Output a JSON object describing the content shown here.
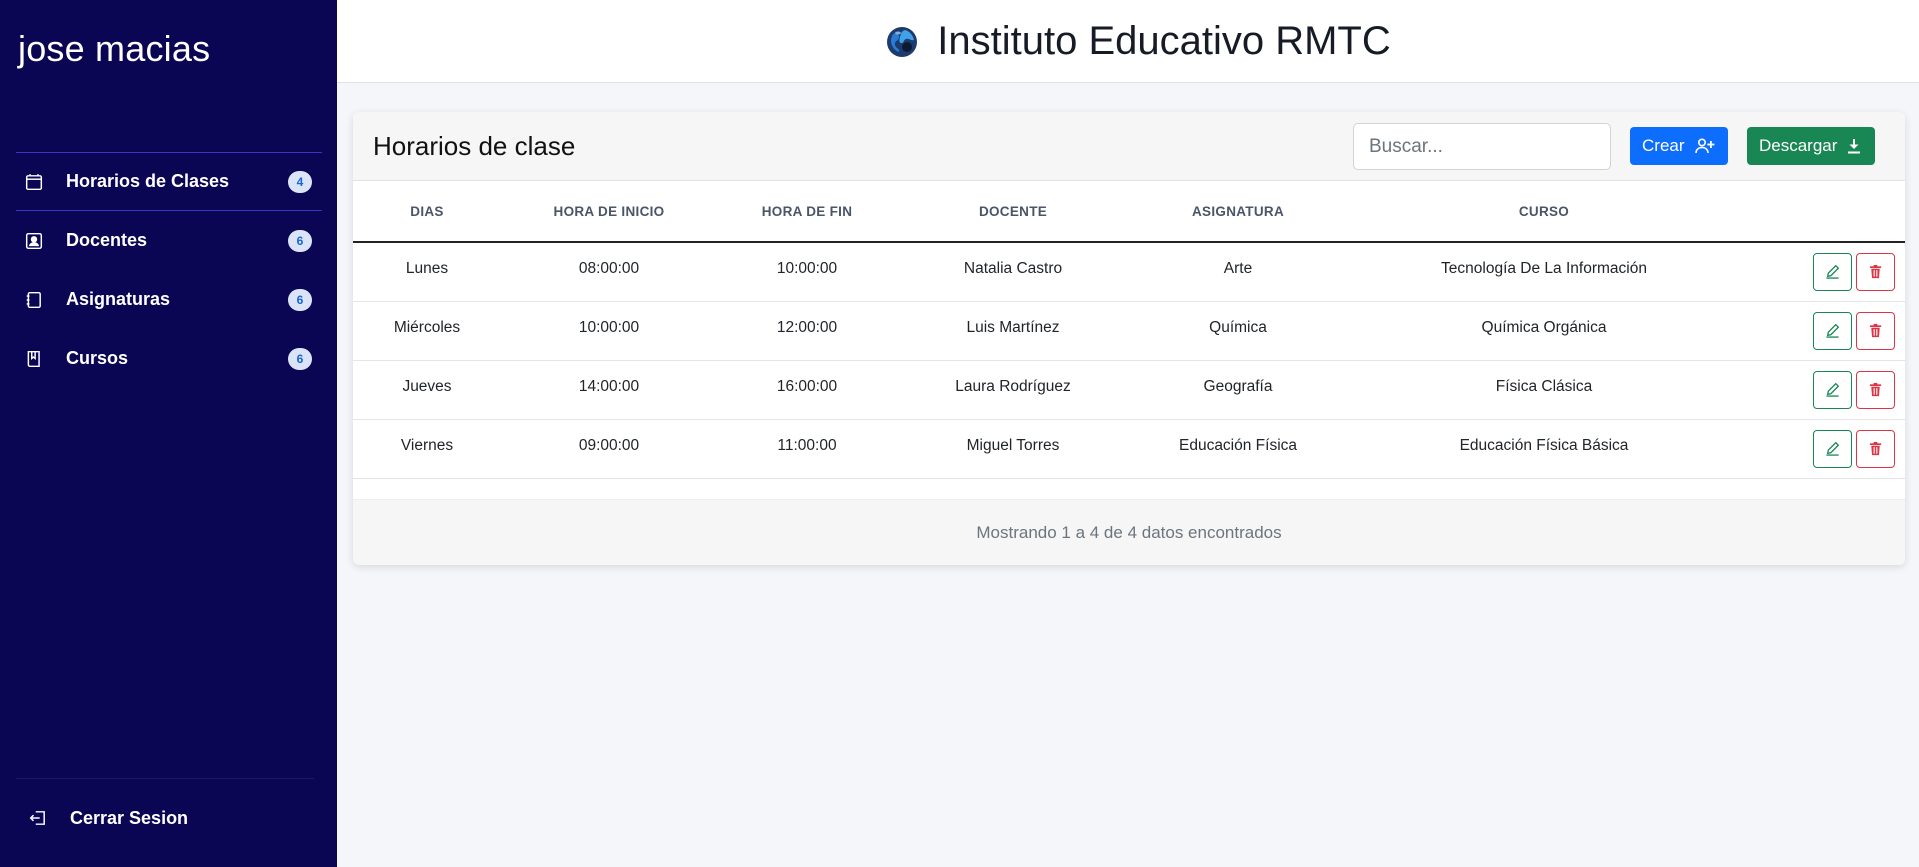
{
  "sidebar": {
    "user_name": "jose macias",
    "items": [
      {
        "label": "Horarios de Clases",
        "badge": "4",
        "icon": "calendar-icon"
      },
      {
        "label": "Docentes",
        "badge": "6",
        "icon": "person-badge-icon"
      },
      {
        "label": "Asignaturas",
        "badge": "6",
        "icon": "journal-icon"
      },
      {
        "label": "Cursos",
        "badge": "6",
        "icon": "bookmark-book-icon"
      }
    ],
    "logout_label": "Cerrar Sesion"
  },
  "header": {
    "title": "Instituto Educativo RMTC",
    "logo_icon": "globe-icon"
  },
  "card": {
    "title": "Horarios de clase",
    "search_placeholder": "Buscar...",
    "create_label": "Crear",
    "download_label": "Descargar",
    "footer_text": "Mostrando 1 a 4 de 4 datos encontrados"
  },
  "table": {
    "columns": [
      "DIAS",
      "HORA DE INICIO",
      "HORA DE FIN",
      "DOCENTE",
      "ASIGNATURA",
      "CURSO"
    ],
    "rows": [
      [
        "Lunes",
        "08:00:00",
        "10:00:00",
        "Natalia Castro",
        "Arte",
        "Tecnología De La Información"
      ],
      [
        "Miércoles",
        "10:00:00",
        "12:00:00",
        "Luis Martínez",
        "Química",
        "Química Orgánica"
      ],
      [
        "Jueves",
        "14:00:00",
        "16:00:00",
        "Laura Rodríguez",
        "Geografía",
        "Física Clásica"
      ],
      [
        "Viernes",
        "09:00:00",
        "11:00:00",
        "Miguel Torres",
        "Educación Física",
        "Educación Física Básica"
      ]
    ]
  },
  "colors": {
    "sidebar_bg": "#0b0654",
    "primary": "#0d6efd",
    "success": "#198754",
    "danger": "#dc3545"
  }
}
